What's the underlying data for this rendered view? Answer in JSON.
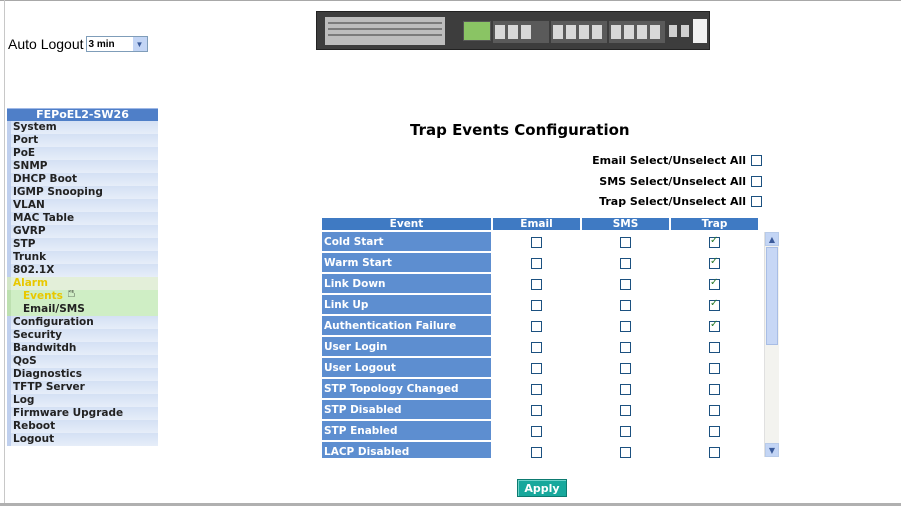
{
  "auto_logout": {
    "label": "Auto Logout",
    "value": "3 min"
  },
  "sidebar": {
    "title": "FEPoEL2-SW26",
    "items": [
      {
        "label": "System"
      },
      {
        "label": "Port"
      },
      {
        "label": "PoE"
      },
      {
        "label": "SNMP"
      },
      {
        "label": "DHCP Boot"
      },
      {
        "label": "IGMP Snooping"
      },
      {
        "label": "VLAN"
      },
      {
        "label": "MAC Table"
      },
      {
        "label": "GVRP"
      },
      {
        "label": "STP"
      },
      {
        "label": "Trunk"
      },
      {
        "label": "802.1X"
      },
      {
        "label": "Alarm"
      },
      {
        "label": "Events"
      },
      {
        "label": "Email/SMS"
      },
      {
        "label": "Configuration"
      },
      {
        "label": "Security"
      },
      {
        "label": "Bandwitdh"
      },
      {
        "label": "QoS"
      },
      {
        "label": "Diagnostics"
      },
      {
        "label": "TFTP Server"
      },
      {
        "label": "Log"
      },
      {
        "label": "Firmware Upgrade"
      },
      {
        "label": "Reboot"
      },
      {
        "label": "Logout"
      }
    ]
  },
  "main": {
    "title": "Trap Events Configuration",
    "select_all": {
      "email": "Email Select/Unselect All",
      "sms": "SMS Select/Unselect All",
      "trap": "Trap Select/Unselect All"
    },
    "table": {
      "headers": [
        "Event",
        "Email",
        "SMS",
        "Trap"
      ],
      "rows": [
        {
          "event": "Cold Start",
          "email": false,
          "sms": false,
          "trap": true
        },
        {
          "event": "Warm Start",
          "email": false,
          "sms": false,
          "trap": true
        },
        {
          "event": "Link Down",
          "email": false,
          "sms": false,
          "trap": true
        },
        {
          "event": "Link Up",
          "email": false,
          "sms": false,
          "trap": true
        },
        {
          "event": "Authentication Failure",
          "email": false,
          "sms": false,
          "trap": true
        },
        {
          "event": "User Login",
          "email": false,
          "sms": false,
          "trap": false
        },
        {
          "event": "User Logout",
          "email": false,
          "sms": false,
          "trap": false
        },
        {
          "event": "STP Topology Changed",
          "email": false,
          "sms": false,
          "trap": false
        },
        {
          "event": "STP Disabled",
          "email": false,
          "sms": false,
          "trap": false
        },
        {
          "event": "STP Enabled",
          "email": false,
          "sms": false,
          "trap": false
        },
        {
          "event": "LACP Disabled",
          "email": false,
          "sms": false,
          "trap": false
        }
      ]
    },
    "apply_label": "Apply"
  },
  "colors": {
    "header_blue": "#3f7ac3",
    "event_cell_blue": "#5d8ed0",
    "apply_teal": "#17a89c",
    "alarm_yellow": "#e8c800"
  },
  "icons": {
    "select_arrow": "chevron-down-icon",
    "hand_cursor": "hand-pointer-icon",
    "scroll_up": "scroll-up-arrow-icon",
    "scroll_down": "scroll-down-arrow-icon",
    "check": "checkmark-icon"
  }
}
